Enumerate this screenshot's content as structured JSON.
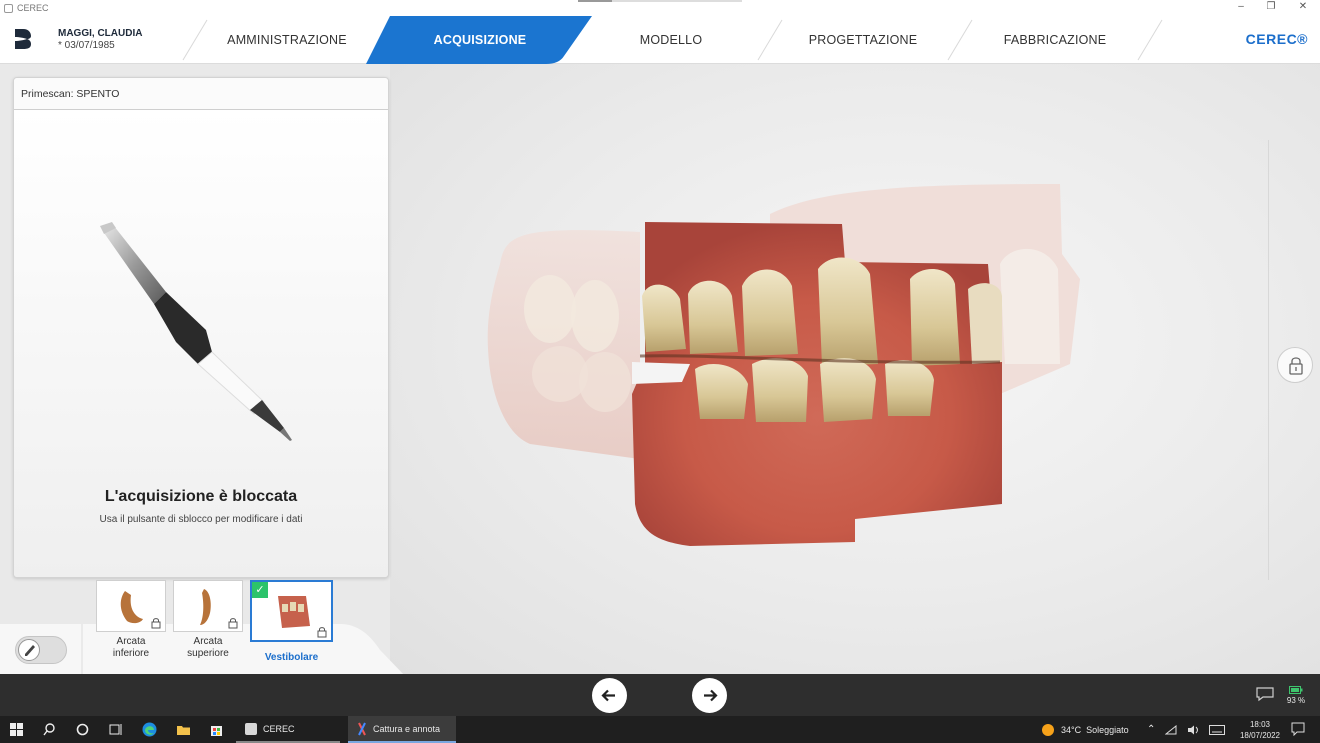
{
  "window": {
    "title": "CEREC",
    "controls": [
      "–",
      "❐",
      "✕"
    ]
  },
  "header": {
    "patient_name": "MAGGI, CLAUDIA",
    "patient_dob": "* 03/07/1985",
    "steps": [
      {
        "label": "AMMINISTRAZIONE",
        "active": false
      },
      {
        "label": "ACQUISIZIONE",
        "active": true
      },
      {
        "label": "MODELLO",
        "active": false
      },
      {
        "label": "PROGETTAZIONE",
        "active": false
      },
      {
        "label": "FABBRICAZIONE",
        "active": false
      }
    ],
    "brand": "CEREC®",
    "accent_color": "#1b75d0"
  },
  "panel": {
    "header": "Primescan: SPENTO",
    "lock_title": "L'acquisizione è bloccata",
    "lock_subtitle": "Usa il pulsante di sblocco per modificare i dati"
  },
  "catalog": {
    "items": [
      {
        "label_line1": "Arcata",
        "label_line2": "inferiore",
        "locked": true,
        "active": false
      },
      {
        "label_line1": "Arcata",
        "label_line2": "superiore",
        "locked": true,
        "active": false
      },
      {
        "label_line1": "Vestibolare",
        "label_line2": "",
        "locked": true,
        "active": true,
        "checked": true
      }
    ]
  },
  "icons": {
    "prev": "arrow-left-icon",
    "next": "arrow-right-icon",
    "unlock": "lock-icon",
    "comment": "comment-icon",
    "battery": "battery-icon"
  },
  "status": {
    "battery_percent": "93 %"
  },
  "taskbar": {
    "apps": [
      {
        "label": "CEREC",
        "active": false
      },
      {
        "label": "Cattura e annota",
        "active": true
      }
    ],
    "weather_temp": "34°C",
    "weather_text": "Soleggiato",
    "time": "18:03",
    "date": "18/07/2022"
  }
}
